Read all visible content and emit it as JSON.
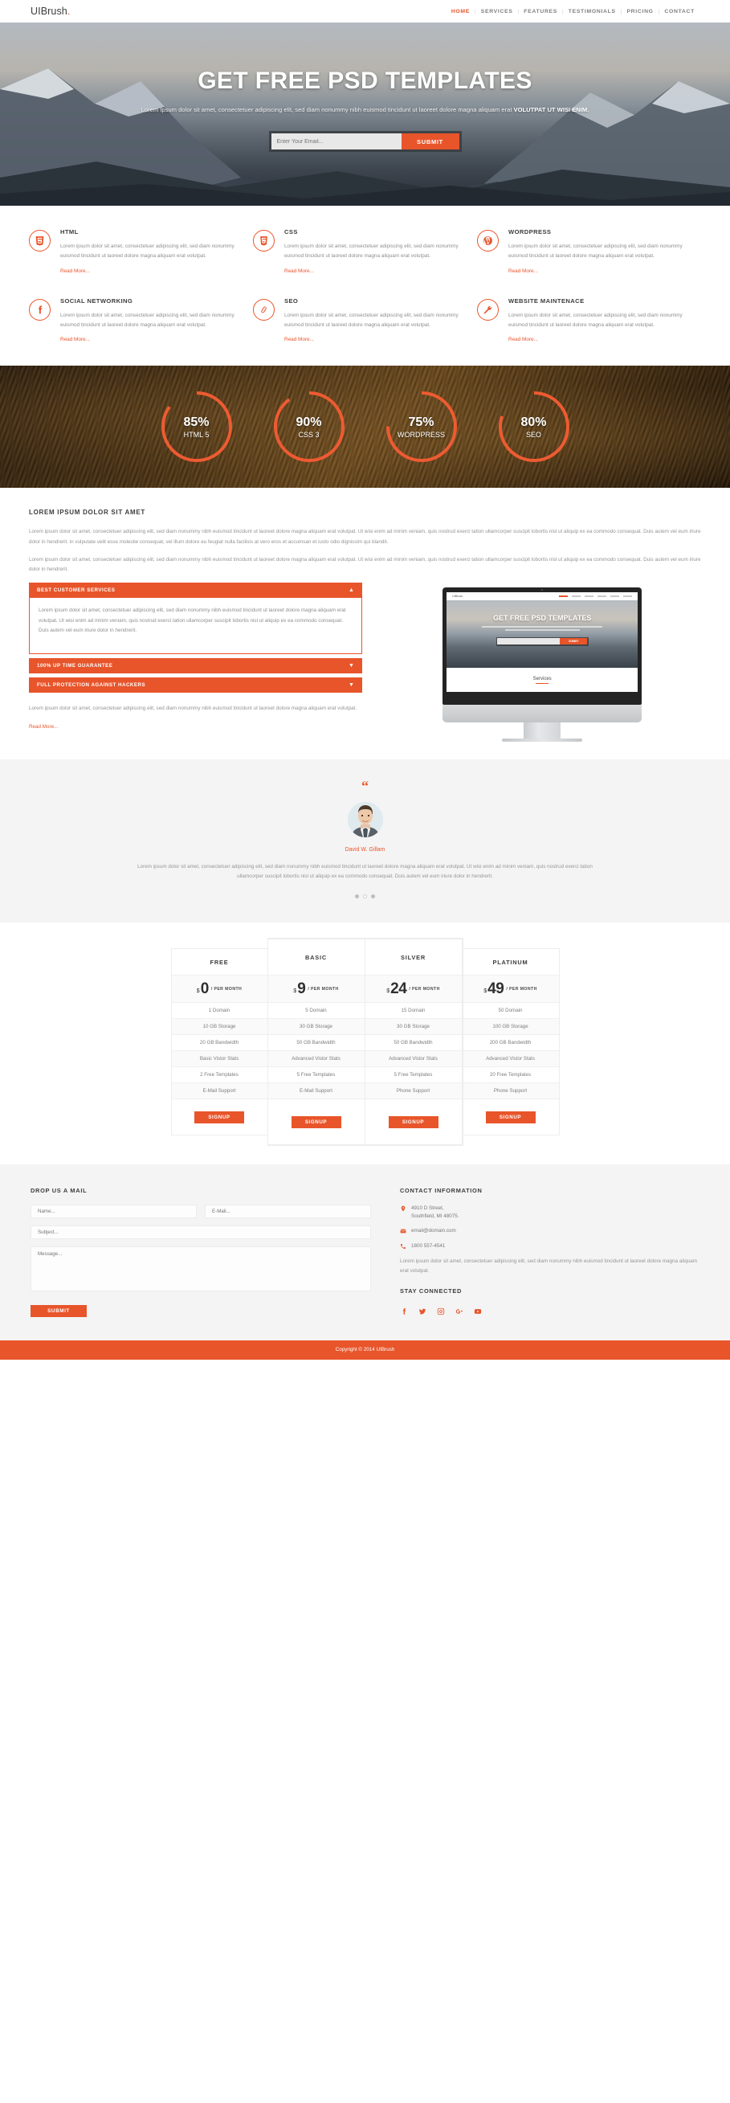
{
  "header": {
    "logo": "UIBrush",
    "logo_dot": ".",
    "nav": [
      {
        "label": "HOME",
        "active": true
      },
      {
        "label": "SERVICES",
        "active": false
      },
      {
        "label": "FEATURES",
        "active": false
      },
      {
        "label": "TESTIMONIALS",
        "active": false
      },
      {
        "label": "PRICING",
        "active": false
      },
      {
        "label": "CONTACT",
        "active": false
      }
    ]
  },
  "hero": {
    "title": "GET FREE PSD TEMPLATES",
    "subtitle_plain": "Lorem Ipsum dolor sit amet, consectetuer adipiscing elit, sed diam nonummy nibh euismod tincidunt ut laoreet dolore magna aliquam erat ",
    "subtitle_bold": "VOLUTPAT UT WISI ENIM.",
    "email_placeholder": "Enter Your Email...",
    "email_value": "",
    "submit_label": "SUBMIT"
  },
  "services": [
    {
      "icon": "html5-icon",
      "title": "HTML",
      "text": "Lorem ipsum dolor sit amet, consectetuer adipiscing elit, sed diam nonummy euismod tincidunt ut laoreet dolore magna aliquam erat volutpat.",
      "link": "Read More..."
    },
    {
      "icon": "css3-icon",
      "title": "CSS",
      "text": "Lorem ipsum dolor sit amet, consectetuer adipiscing elit, sed diam nonummy euismod tincidunt ut laoreet dolore magna aliquam erat volutpat.",
      "link": "Read More..."
    },
    {
      "icon": "wordpress-icon",
      "title": "WORDPRESS",
      "text": "Lorem ipsum dolor sit amet, consectetuer adipiscing elit, sed diam nonummy euismod tincidunt ut laoreet dolore magna aliquam erat volutpat.",
      "link": "Read More..."
    },
    {
      "icon": "facebook-icon",
      "title": "SOCIAL NETWORKING",
      "text": "Lorem ipsum dolor sit amet, consectetuer adipiscing elit, sed diam nonummy euismod tincidunt ut laoreet dolore magna aliquam erat volutpat.",
      "link": "Read More..."
    },
    {
      "icon": "link-chain-icon",
      "title": "SEO",
      "text": "Lorem ipsum dolor sit amet, consectetuer adipiscing elit, sed diam nonummy euismod tincidunt ut laoreet dolore magna aliquam erat volutpat.",
      "link": "Read More..."
    },
    {
      "icon": "wrench-icon",
      "title": "WEBSITE MAINTENACE",
      "text": "Lorem ipsum dolor sit amet, consectetuer adipiscing elit, sed diam nonummy euismod tincidunt ut laoreet dolore magna aliquam erat volutpat.",
      "link": "Read More..."
    }
  ],
  "chart_data": {
    "type": "pie",
    "title": "Skills",
    "accent": "#ee5b32",
    "categories": [
      "HTML 5",
      "CSS 3",
      "WORDPRESS",
      "SEO"
    ],
    "values": [
      85,
      90,
      75,
      80
    ],
    "unit": "%",
    "labels": [
      "85%",
      "90%",
      "75%",
      "80%"
    ]
  },
  "about": {
    "heading": "LOREM IPSUM DOLOR SIT AMET",
    "p1": "Lorem ipsum dolor sit amet, consectetuer adipiscing elit, sed diam nonummy nibh euismod tincidunt ut laoreet dolore magna aliquam erat volutpat. Ut wisi enim ad minim veniam, quis nostrud exerci tation ullamcorper suscipit lobortis nisl ut aliquip ex ea commodo consequat. Duis autem vel eum iriure dolor in hendrerit. in vulputate velit esse molestie consequat, vel illum dolore eu feugiat nulla facilisis at vero eros et accumsan et iusto odio dignissim qui blandit.",
    "p2": "Lorem ipsum dolor sit amet, consectetuer adipiscing elit, sed diam nonummy nibh euismod tincidunt ut laoreet dolore magna aliquam erat volutpat. Ut wisi enim ad minim veniam, quis nostrud exerci tation ullamcorper suscipit lobortis nisl ut aliquip ex ea commodo consequat. Duis autem vel eum iriure dolor in hendrerit."
  },
  "accordion": {
    "items": [
      {
        "title": "BEST CUSTOMER SERVICES",
        "open": true,
        "arrow": "▲",
        "body": "Lorem ipsum dolor sit amet, consectetuer adipiscing elit, sed diam nonummy nibh euismod tincidunt ut laoreet dolore magna aliquam erat volutpat. Ut wisi enim ad minim veniam, quis nostrud exerci tation ullamcorper suscipit lobortis nisl ut aliquip ex ea commodo consequat. Duis autem vel eum iriure dolor in hendrerit."
      },
      {
        "title": "100% UP TIME GUARANTEE",
        "open": false,
        "arrow": "▼",
        "body": ""
      },
      {
        "title": "FULL PROTECTION AGAINST HACKERS",
        "open": false,
        "arrow": "▼",
        "body": ""
      }
    ],
    "footer_text": "Lorem ipsum dolor sit amet, consectetuer adipiscing elit, sed diam nonummy nibh euismod tincidunt ut laoreet dolore magna aliquam erat volutpat.",
    "footer_link": "Read More..."
  },
  "monitor": {
    "logo": "UIBrush.",
    "hero_title": "GET FREE PSD TEMPLATES",
    "submit_label": "SUBMIT",
    "section_label": "Services"
  },
  "testimonial": {
    "quote_glyph": "“",
    "name": "David W. Gillam",
    "text": "Lorem ipsum dolor sit amet, consectetuer adipiscing elit, sed diam nonummy nibh euismod tincidunt ut laoreet dolore magna aliquam erat volutpat. Ut wisi enim ad minim veniam, quis nostrud exerci tation ullamcorper suscipit lobortis nisl ut aliquip ex ea commodo consequat. Duis autem vel eum iriure dolor in hendrerit."
  },
  "pricing": {
    "plans": [
      {
        "name": "FREE",
        "currency": "$",
        "amount": "0",
        "period": "/ PER MONTH",
        "featured": false,
        "features": [
          "1 Domain",
          "10 GB Storage",
          "20 GB Bandwidth",
          "Basic Vistor Stats",
          "2 Free Templates",
          "E-Mail Support"
        ],
        "cta": "SIGNUP"
      },
      {
        "name": "BASIC",
        "currency": "$",
        "amount": "9",
        "period": "/ PER MONTH",
        "featured": true,
        "features": [
          "5 Domain",
          "30 GB Storage",
          "50 GB Bandwidth",
          "Advanced Vistor Stats",
          "5 Free Templates",
          "E-Mail Support"
        ],
        "cta": "SIGNUP"
      },
      {
        "name": "SILVER",
        "currency": "$",
        "amount": "24",
        "period": "/ PER MONTH",
        "featured": true,
        "features": [
          "15 Domain",
          "30 GB Storage",
          "50 GB Bandwidth",
          "Advanced Vistor Stats",
          "5 Free Templates",
          "Phone Support"
        ],
        "cta": "SIGNUP"
      },
      {
        "name": "PLATINUM",
        "currency": "$",
        "amount": "49",
        "period": "/ PER MONTH",
        "featured": false,
        "features": [
          "50 Domain",
          "100 GB Storage",
          "200 GB Bandwidth",
          "Advanced Vistor Stats",
          "20 Free Templates",
          "Phone Support"
        ],
        "cta": "SIGNUP"
      }
    ]
  },
  "contact_form": {
    "heading": "DROP US A MAIL",
    "name_placeholder": "Name...",
    "email_placeholder": "E-Mail...",
    "subject_placeholder": "Subject...",
    "message_placeholder": "Message...",
    "name_value": "",
    "email_value": "",
    "subject_value": "",
    "message_value": "",
    "submit_label": "SUBMIT"
  },
  "contact_info": {
    "heading": "CONTACT INFORMATION",
    "address_line1": "4910 D Street,",
    "address_line2": "Southfield, MI 48075.",
    "email": "email@domain.com",
    "phone": "1800 557-4541",
    "description": "Lorem ipsum dolor sit amet, consectetuer adipiscing elit, sed diam nonummy nibh euismod tincidunt ut laoreet dolore magna aliquam erat volutpat.",
    "stay_connected": "STAY CONNECTED",
    "socials": [
      "facebook-icon",
      "twitter-icon",
      "instagram-icon",
      "google-plus-icon",
      "youtube-icon"
    ]
  },
  "copyright": "Copyright © 2014 UIBrush",
  "colors": {
    "accent": "#e8552b",
    "dark_text": "#3c3c3c",
    "body_text": "#8d8e90",
    "light_bg": "#f4f4f4"
  }
}
